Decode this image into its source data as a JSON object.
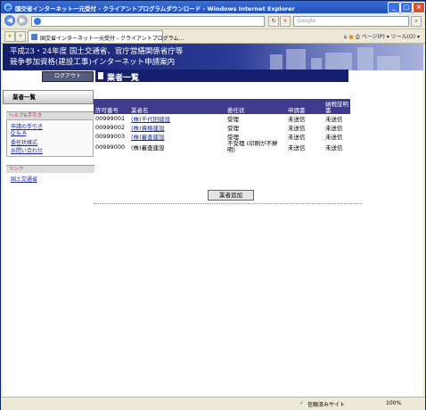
{
  "window": {
    "title": "国交省インターネット一元受付 - クライアントプログラムダウンロード - Windows Internet Explorer",
    "address": "",
    "search_placeholder": "Google",
    "tab_label": "国交省インターネット一元受付 - クライアントプログラム...",
    "toolbar_items": "ページ(P) ▾ ツール(O) ▾",
    "status_zone": "信頼済みサイト",
    "zoom": "100%"
  },
  "banner": {
    "line1": "平成23・24年度 国土交通省、官庁営繕関係省庁等",
    "line2": "競争参加資格(建設工事)インターネット申請案内"
  },
  "logout_label": "ログアウト",
  "page_title": "業者一覧",
  "sidebar": {
    "main_button": "業者一覧",
    "help_header": "ヘルプ&手引き",
    "help_links": [
      "申請の手引き",
      "Q & A",
      "委任状様式",
      "お問い合わせ"
    ],
    "link_header": "リンク",
    "links": [
      "国土交通省"
    ]
  },
  "table": {
    "headers": [
      "許可番号",
      "業者名",
      "委任状",
      "申請書",
      "納税証明書"
    ],
    "rows": [
      {
        "no": "00999001",
        "name": "(株)千代田建設",
        "proxy": "受理",
        "app": "未送信",
        "tax": "未送信"
      },
      {
        "no": "00999002",
        "name": "(株)資格建設",
        "proxy": "受理",
        "app": "未送信",
        "tax": "未送信"
      },
      {
        "no": "00999003",
        "name": "(株)審査建設",
        "proxy": "受理",
        "app": "未送信",
        "tax": "未送信"
      },
      {
        "no": "00999000",
        "name": "(株)審査建設",
        "proxy": "不受理 (印刷が不鮮明)",
        "app": "未送信",
        "tax": "未送信"
      }
    ]
  },
  "add_button": "業者追加"
}
